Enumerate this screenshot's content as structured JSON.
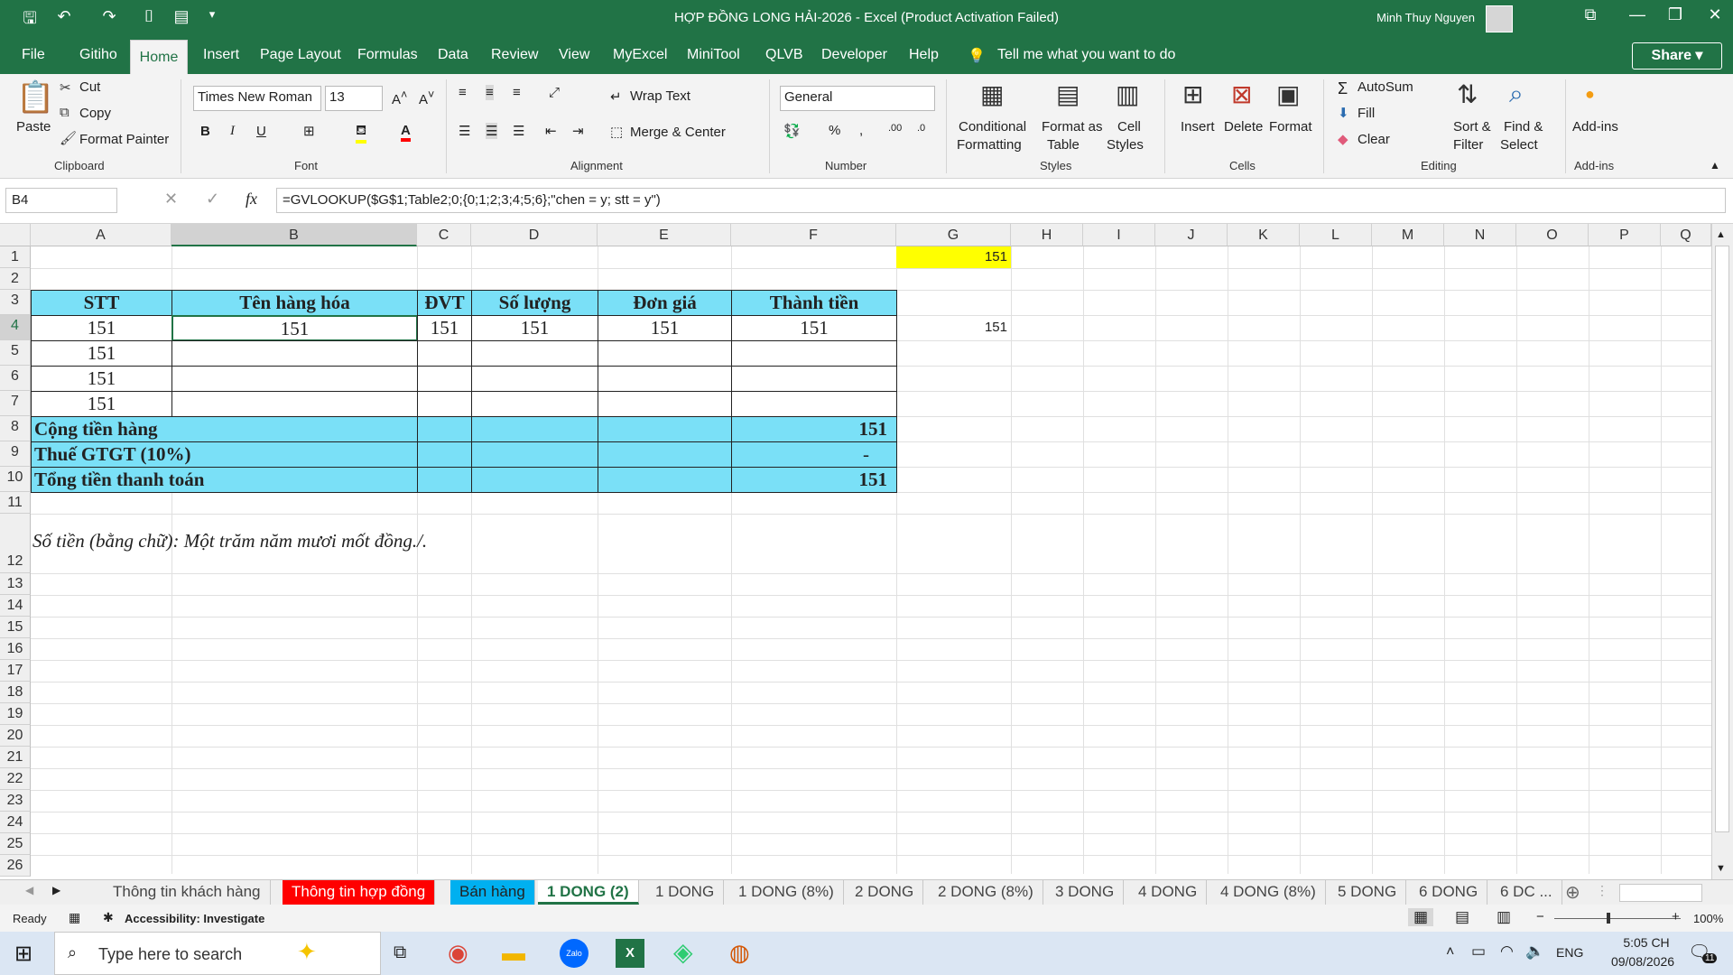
{
  "title": "HỢP ĐỒNG LONG HẢI-2026  -  Excel (Product Activation Failed)",
  "user": "Minh Thuy Nguyen",
  "menu": [
    "File",
    "Gitiho",
    "Home",
    "Insert",
    "Page Layout",
    "Formulas",
    "Data",
    "Review",
    "View",
    "MyExcel",
    "MiniTool",
    "QLVB",
    "Developer",
    "Help"
  ],
  "tell_me": "Tell me what you want to do",
  "share": "Share",
  "ribbon": {
    "paste": "Paste",
    "cut": "Cut",
    "copy": "Copy",
    "format_painter": "Format Painter",
    "clipboard": "Clipboard",
    "font_name": "Times New Roman",
    "font_size": "13",
    "font": "Font",
    "wrap_text": "Wrap Text",
    "merge_center": "Merge & Center",
    "alignment": "Alignment",
    "number_format": "General",
    "number": "Number",
    "cond_fmt_1": "Conditional",
    "cond_fmt_2": "Formatting",
    "fmt_table_1": "Format as",
    "fmt_table_2": "Table",
    "cell_styles_1": "Cell",
    "cell_styles_2": "Styles",
    "styles": "Styles",
    "insert": "Insert",
    "delete": "Delete",
    "format": "Format",
    "cells": "Cells",
    "autosum": "AutoSum",
    "fill": "Fill",
    "clear": "Clear",
    "sort_1": "Sort &",
    "sort_2": "Filter",
    "find_1": "Find &",
    "find_2": "Select",
    "editing": "Editing",
    "addins": "Add-ins",
    "addins_group": "Add-ins"
  },
  "name_box": "B4",
  "formula": "=GVLOOKUP($G$1;Table2;0;{0;1;2;3;4;5;6};\"chen = y; stt = y\")",
  "columns": [
    "A",
    "B",
    "C",
    "D",
    "E",
    "F",
    "G",
    "H",
    "I",
    "J",
    "K",
    "L",
    "M",
    "N",
    "O",
    "P",
    "Q"
  ],
  "rows": [
    "1",
    "2",
    "3",
    "4",
    "5",
    "6",
    "7",
    "8",
    "9",
    "10",
    "11",
    "12",
    "13",
    "14",
    "15",
    "16",
    "17",
    "18",
    "19",
    "20",
    "21",
    "22",
    "23",
    "24",
    "25",
    "26"
  ],
  "cells": {
    "g1": "151",
    "h_stt": "STT",
    "h_ten": "Tên hàng hóa",
    "h_dvt": "ĐVT",
    "h_sl": "Số lượng",
    "h_dg": "Đơn giá",
    "h_tt": "Thành tiền",
    "a4": "151",
    "b4": "151",
    "c4": "151",
    "d4": "151",
    "e4": "151",
    "f4": "151",
    "g4": "151",
    "a5": "151",
    "a6": "151",
    "a7": "151",
    "l8": "Cộng tiền hàng",
    "f8": "151",
    "l9": "Thuế GTGT (10%)",
    "f9": "-",
    "l10": "Tổng tiền thanh toán",
    "f10": "151",
    "a12": "Số tiền (bằng chữ): Một trăm năm mươi mốt đồng./."
  },
  "tabs": [
    "Thông tin khách hàng",
    "Thông tin hợp đồng",
    "Bán hàng",
    "1 DONG (2)",
    "1 DONG",
    "1 DONG (8%)",
    "2 DONG",
    "2 DONG (8%)",
    "3 DONG",
    "4 DONG",
    "4 DONG (8%)",
    "5 DONG",
    "6 DONG",
    "6 DC ..."
  ],
  "status": {
    "ready": "Ready",
    "accessibility": "Accessibility: Investigate",
    "zoom": "100%"
  },
  "taskbar": {
    "search": "Type here to search",
    "lang": "ENG",
    "time": "5:05 CH",
    "date": "09/08/2026",
    "notif": "11"
  },
  "colors": {
    "excel_green": "#217346",
    "header_cyan": "#7ae0f7",
    "highlight_yellow": "#ffff00",
    "tab_red": "#ff0000",
    "tab_blue": "#00b0f0"
  }
}
